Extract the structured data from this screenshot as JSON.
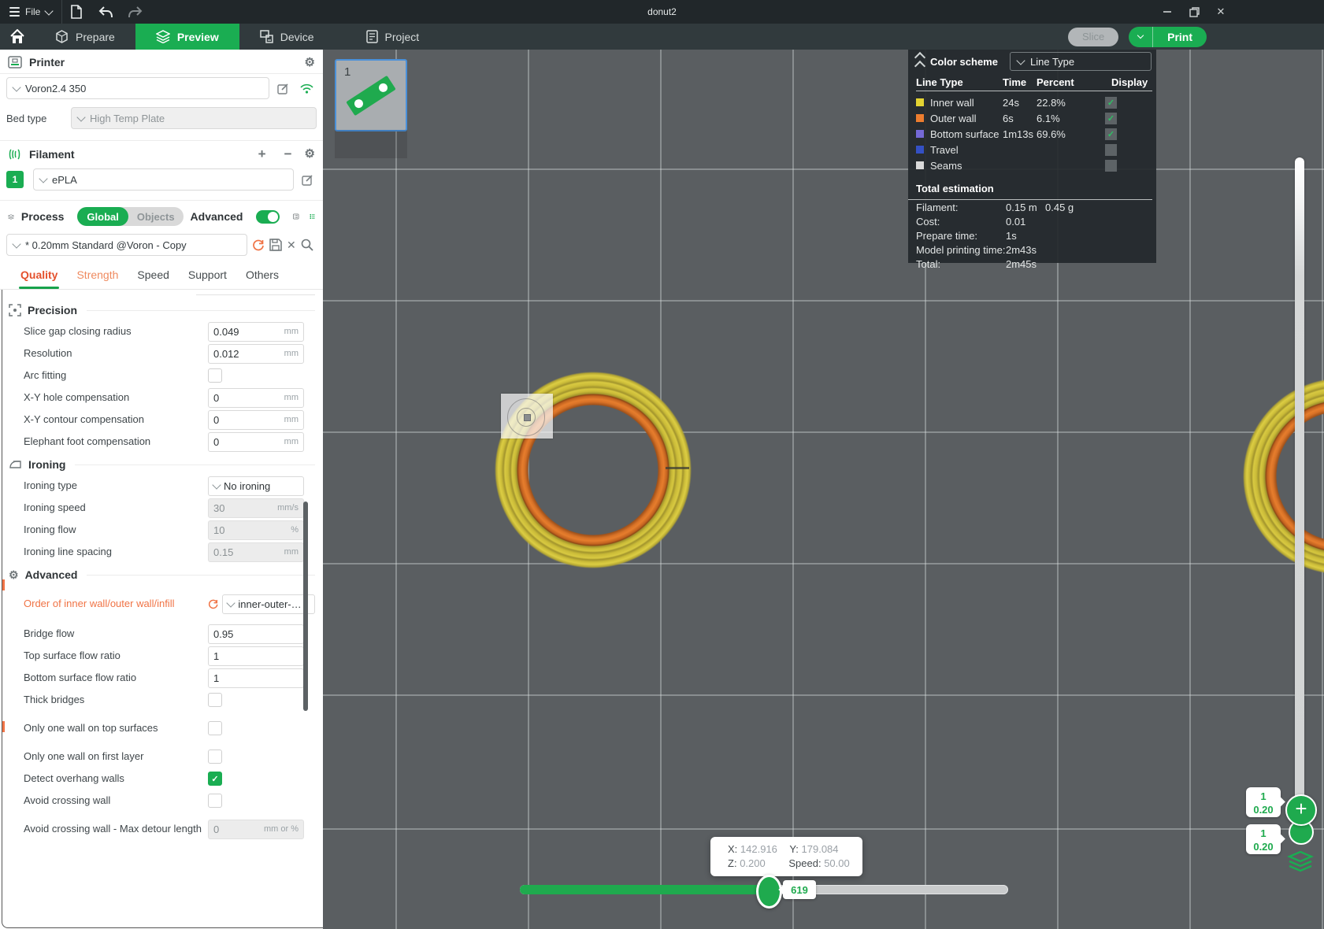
{
  "window": {
    "title": "donut2",
    "file_menu": "File"
  },
  "toolbar": {
    "slice_label": "Slice",
    "print_label": "Print"
  },
  "nav": {
    "tabs": [
      {
        "label": "Prepare"
      },
      {
        "label": "Preview"
      },
      {
        "label": "Device"
      },
      {
        "label": "Project"
      }
    ]
  },
  "printer": {
    "header": "Printer",
    "name": "Voron2.4 350",
    "bed_type_label": "Bed type",
    "bed_type_value": "High Temp Plate"
  },
  "filament": {
    "header": "Filament",
    "slot": "1",
    "name": "ePLA"
  },
  "process": {
    "header": "Process",
    "scope_global": "Global",
    "scope_objects": "Objects",
    "advanced_label": "Advanced",
    "preset": "* 0.20mm Standard @Voron - Copy",
    "tabs": [
      "Quality",
      "Strength",
      "Speed",
      "Support",
      "Others"
    ]
  },
  "settings": {
    "precision": {
      "title": "Precision",
      "fields": [
        {
          "label": "Slice gap closing radius",
          "value": "0.049",
          "unit": "mm"
        },
        {
          "label": "Resolution",
          "value": "0.012",
          "unit": "mm"
        },
        {
          "label": "Arc fitting",
          "checked": false
        },
        {
          "label": "X-Y hole compensation",
          "value": "0",
          "unit": "mm"
        },
        {
          "label": "X-Y contour compensation",
          "value": "0",
          "unit": "mm"
        },
        {
          "label": "Elephant foot compensation",
          "value": "0",
          "unit": "mm"
        }
      ]
    },
    "ironing": {
      "title": "Ironing",
      "fields": [
        {
          "label": "Ironing type",
          "value": "No ironing"
        },
        {
          "label": "Ironing speed",
          "value": "30",
          "unit": "mm/s"
        },
        {
          "label": "Ironing flow",
          "value": "10",
          "unit": "%"
        },
        {
          "label": "Ironing line spacing",
          "value": "0.15",
          "unit": "mm"
        }
      ]
    },
    "advanced": {
      "title": "Advanced",
      "fields": [
        {
          "label": "Order of inner wall/outer wall/infill",
          "value": "inner-outer-…",
          "modified": true
        },
        {
          "label": "Bridge flow",
          "value": "0.95"
        },
        {
          "label": "Top surface flow ratio",
          "value": "1"
        },
        {
          "label": "Bottom surface flow ratio",
          "value": "1"
        },
        {
          "label": "Thick bridges",
          "checked": false
        },
        {
          "label": "Only one wall on top surfaces",
          "checked": false
        },
        {
          "label": "Only one wall on first layer",
          "checked": false
        },
        {
          "label": "Detect overhang walls",
          "checked": true
        },
        {
          "label": "Avoid crossing wall",
          "checked": false
        },
        {
          "label": "Avoid crossing wall - Max detour length",
          "value": "0",
          "unit": "mm or %"
        }
      ]
    }
  },
  "plate": {
    "number": "1"
  },
  "legend": {
    "header": "Color scheme",
    "scheme_value": "Line Type",
    "columns": [
      "Line Type",
      "Time",
      "Percent",
      "Display"
    ],
    "rows": [
      {
        "label": "Inner wall",
        "color": "#e3d332",
        "time": "24s",
        "percent": "22.8%",
        "display": true
      },
      {
        "label": "Outer wall",
        "color": "#ed7d2f",
        "time": "6s",
        "percent": "6.1%",
        "display": true
      },
      {
        "label": "Bottom surface",
        "color": "#7569d6",
        "time": "1m13s",
        "percent": "69.6%",
        "display": true
      },
      {
        "label": "Travel",
        "color": "#3450c4",
        "time": "",
        "percent": "",
        "display": false
      },
      {
        "label": "Seams",
        "color": "#d9d9d9",
        "time": "",
        "percent": "",
        "display": false
      }
    ],
    "totals": {
      "title": "Total estimation",
      "rows": [
        {
          "label": "Filament:",
          "value": "0.15 m",
          "value2": "0.45 g"
        },
        {
          "label": "Cost:",
          "value": "0.01",
          "value2": ""
        },
        {
          "label": "Prepare time:",
          "value": "1s",
          "value2": ""
        },
        {
          "label": "Model printing time:",
          "value": "2m43s",
          "value2": ""
        },
        {
          "label": "Total:",
          "value": "2m45s",
          "value2": ""
        }
      ]
    }
  },
  "viewport_ui": {
    "tooltip": {
      "x_label": "X:",
      "x_value": "142.916",
      "y_label": "Y:",
      "y_value": "179.084",
      "z_label": "Z:",
      "z_value": "0.200",
      "speed_label": "Speed:",
      "speed_value": "50.00"
    },
    "move_slider": {
      "value": "619"
    },
    "layer_slider": {
      "badge1_layer": "1",
      "badge1_height": "0.20",
      "badge2_layer": "1",
      "badge2_height": "0.20"
    }
  },
  "icons": {
    "gear": "⚙",
    "plus": "+",
    "minus": "−",
    "close": "✕",
    "check": "✓"
  }
}
